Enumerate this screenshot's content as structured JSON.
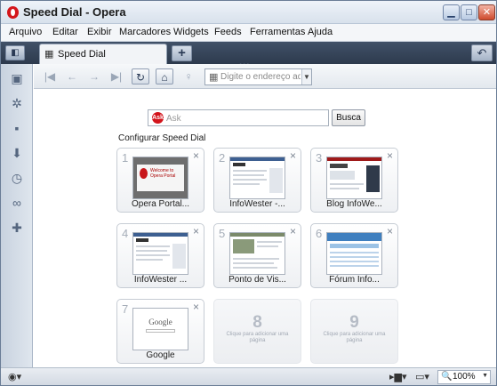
{
  "window": {
    "title": "Speed Dial - Opera",
    "minimize_glyph": "▁",
    "maximize_glyph": "□",
    "close_glyph": "✕"
  },
  "menu": [
    "Arquivo",
    "Editar",
    "Exibir",
    "Marcadores",
    "Widgets",
    "Feeds",
    "Ferramentas",
    "Ajuda"
  ],
  "tabbar": {
    "tab_label": "Speed Dial",
    "new_tab_glyph": "+",
    "closed_tabs_glyph": "↶"
  },
  "navbar": {
    "address_placeholder": "Digite o endereço aqui"
  },
  "search": {
    "logo_text": "Ask",
    "placeholder": "Ask",
    "button_label": "Busca"
  },
  "speed_dial": {
    "configure_label": "Configurar Speed Dial",
    "close_glyph": "×",
    "dials": [
      {
        "number": "1",
        "label": "Opera Portal...",
        "thumb": "opera"
      },
      {
        "number": "2",
        "label": "InfoWester -...",
        "thumb": "infowester"
      },
      {
        "number": "3",
        "label": "Blog InfoWe...",
        "thumb": "blog"
      },
      {
        "number": "4",
        "label": "InfoWester ...",
        "thumb": "infowester"
      },
      {
        "number": "5",
        "label": "Ponto de Vis...",
        "thumb": "ponto"
      },
      {
        "number": "6",
        "label": "Fórum Info...",
        "thumb": "forum"
      },
      {
        "number": "7",
        "label": "Google",
        "thumb": "google"
      },
      {
        "number": "8",
        "label": "Clique para adicionar uma página",
        "thumb": "empty"
      },
      {
        "number": "9",
        "label": "Clique para adicionar uma página",
        "thumb": "empty"
      }
    ],
    "thumb_text": {
      "opera": "Welcome to Opera Portal",
      "google": "Google"
    }
  },
  "statusbar": {
    "zoom_value": "100%"
  },
  "icons": {
    "opera_logo": "opera-logo-icon",
    "panel_toggle": "panel-toggle-icon",
    "grid": "speed-dial-grid-icon",
    "new_tab": "plus-icon",
    "closed_tabs": "trash-undo-icon",
    "sidebar": [
      "bookmarks-icon",
      "widgets-icon",
      "notes-icon",
      "downloads-icon",
      "history-icon",
      "links-icon",
      "add-panel-icon"
    ],
    "nav": [
      "rewind-icon",
      "back-icon",
      "forward-icon",
      "fast-forward-icon",
      "reload-icon",
      "home-icon",
      "wand-icon"
    ]
  }
}
